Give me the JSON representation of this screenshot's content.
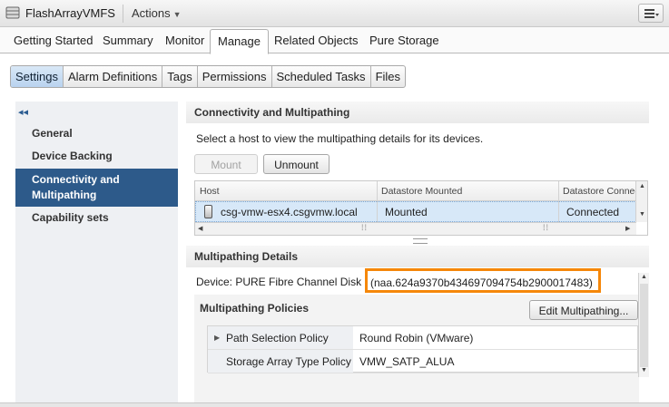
{
  "header": {
    "title": "FlashArrayVMFS",
    "actions_label": "Actions",
    "object_icon": "datastore-icon",
    "menu_icon": "menu-icon"
  },
  "main_tabs": [
    {
      "label": "Getting Started"
    },
    {
      "label": "Summary"
    },
    {
      "label": "Monitor"
    },
    {
      "label": "Manage",
      "active": true
    },
    {
      "label": "Related Objects"
    },
    {
      "label": "Pure Storage"
    }
  ],
  "sub_tabs": [
    {
      "label": "Settings",
      "active": true
    },
    {
      "label": "Alarm Definitions"
    },
    {
      "label": "Tags"
    },
    {
      "label": "Permissions"
    },
    {
      "label": "Scheduled Tasks"
    },
    {
      "label": "Files"
    }
  ],
  "sidebar": {
    "collapse_label": "◂◂",
    "items": [
      {
        "label": "General"
      },
      {
        "label": "Device Backing"
      },
      {
        "label": "Connectivity and Multipathing",
        "active": true
      },
      {
        "label": "Capability sets"
      }
    ]
  },
  "connectivity": {
    "heading": "Connectivity and Multipathing",
    "instruction": "Select a host to view the multipathing details for its devices.",
    "mount_label": "Mount",
    "unmount_label": "Unmount",
    "columns": [
      "Host",
      "Datastore Mounted",
      "Datastore Connec"
    ],
    "rows": [
      {
        "host": "csg-vmw-esx4.csgvmw.local",
        "mounted": "Mounted",
        "connected": "Connected"
      }
    ]
  },
  "details": {
    "heading": "Multipathing Details",
    "device_prefix": "Device: PURE Fibre Channel Disk",
    "device_id": "(naa.624a9370b434697094754b2900017483)",
    "policies_heading": "Multipathing Policies",
    "edit_label": "Edit Multipathing...",
    "policies": [
      {
        "key": "Path Selection Policy",
        "value": "Round Robin (VMware)"
      },
      {
        "key": "Storage Array Type Policy",
        "value": "VMW_SATP_ALUA"
      }
    ]
  },
  "colors": {
    "accent": "#2d5a8a",
    "highlight": "#f5870a",
    "selected_row": "#d7e8f8"
  }
}
